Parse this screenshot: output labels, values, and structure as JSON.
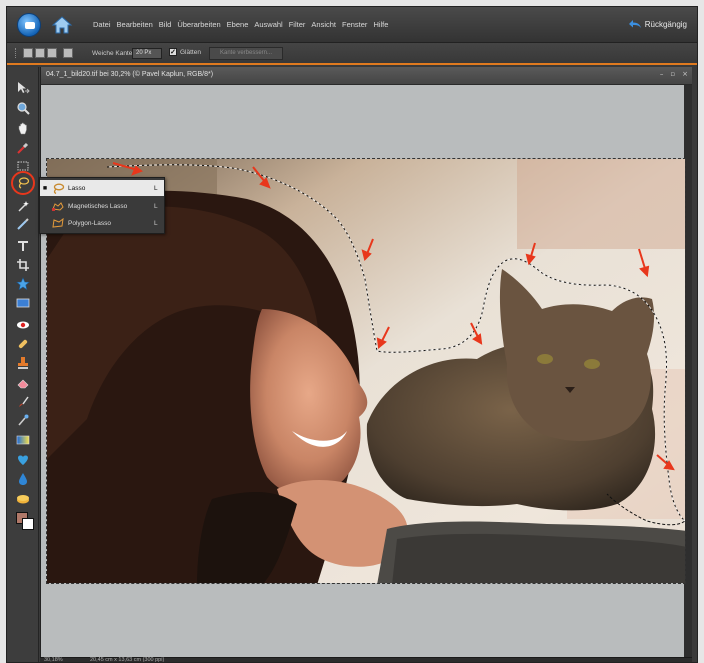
{
  "menubar": {
    "items": [
      "Datei",
      "Bearbeiten",
      "Bild",
      "Überarbeiten",
      "Ebene",
      "Auswahl",
      "Filter",
      "Ansicht",
      "Fenster",
      "Hilfe"
    ],
    "undo_label": "Rückgängig"
  },
  "options": {
    "feather_label": "Weiche Kante:",
    "feather_value": "20 Px",
    "smooth_label": "Glätten",
    "refine_button": "Kante verbessern..."
  },
  "document": {
    "title": "04.7_1_bild20.tif bei 30,2% (© Pavel Kaplun, RGB/8*)",
    "controls": [
      "–",
      "▫",
      "×"
    ]
  },
  "flyout": {
    "items": [
      {
        "label": "Lasso",
        "key": "L",
        "icon": "lasso-icon"
      },
      {
        "label": "Magnetisches Lasso",
        "key": "L",
        "icon": "magnetic-lasso-icon"
      },
      {
        "label": "Polygon-Lasso",
        "key": "L",
        "icon": "polygon-lasso-icon"
      }
    ]
  },
  "status": {
    "zoom": "30,18%",
    "size": "20,45 cm x 13,63 cm (300 ppi)"
  },
  "colors": {
    "accent": "#e07a1f",
    "annotation": "#e8371c",
    "foreground_swatch": "#b07868",
    "background_swatch": "#ffffff"
  }
}
